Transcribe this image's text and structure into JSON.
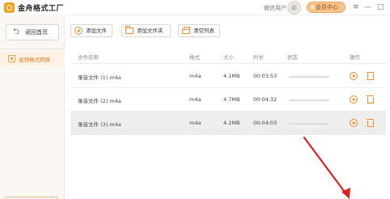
{
  "titlebar": {
    "app_title": "金舟格式工厂",
    "user_label": "微信用户",
    "vip_label": "会员中心",
    "menu_glyph": "≡",
    "minimize_glyph": "—",
    "maximize_glyph": "□"
  },
  "sidebar": {
    "back_label": "返回首页",
    "back_glyph": "⮌",
    "items": [
      {
        "label": "音频格式转换",
        "active": true
      }
    ]
  },
  "toolbar": {
    "add_file_label": "添加文件",
    "add_folder_label": "添加文件夹",
    "clear_list_label": "清空列表"
  },
  "table": {
    "columns": [
      "文件名称",
      "格式",
      "大小",
      "时长",
      "状态",
      "操作"
    ],
    "rows": [
      {
        "name": "录音文件 (1).m4a",
        "format": "m4a",
        "size": "4.1MB",
        "duration": "00:03:53",
        "progress": 0,
        "selected": false
      },
      {
        "name": "录音文件 (2).m4a",
        "format": "m4a",
        "size": "4.7MB",
        "duration": "00:04:32",
        "progress": 0,
        "selected": false
      },
      {
        "name": "录音文件 (3).m4a",
        "format": "m4a",
        "size": "4.2MB",
        "duration": "00:04:03",
        "progress": 0,
        "selected": true
      }
    ]
  },
  "colors": {
    "accent": "#f08a2a",
    "annotation_arrow": "#e02020",
    "vip_button": "#f6c38a",
    "sidebar_bg": "#fbf8f4",
    "selected_row": "#eeeeee"
  },
  "icons": [
    "app-logo-icon",
    "avatar-icon",
    "crown-icon",
    "menu-icon",
    "minimize-icon",
    "maximize-icon",
    "back-arrow-icon",
    "audio-convert-icon",
    "add-file-icon",
    "add-folder-icon",
    "clear-list-icon",
    "play-icon",
    "delete-icon"
  ]
}
